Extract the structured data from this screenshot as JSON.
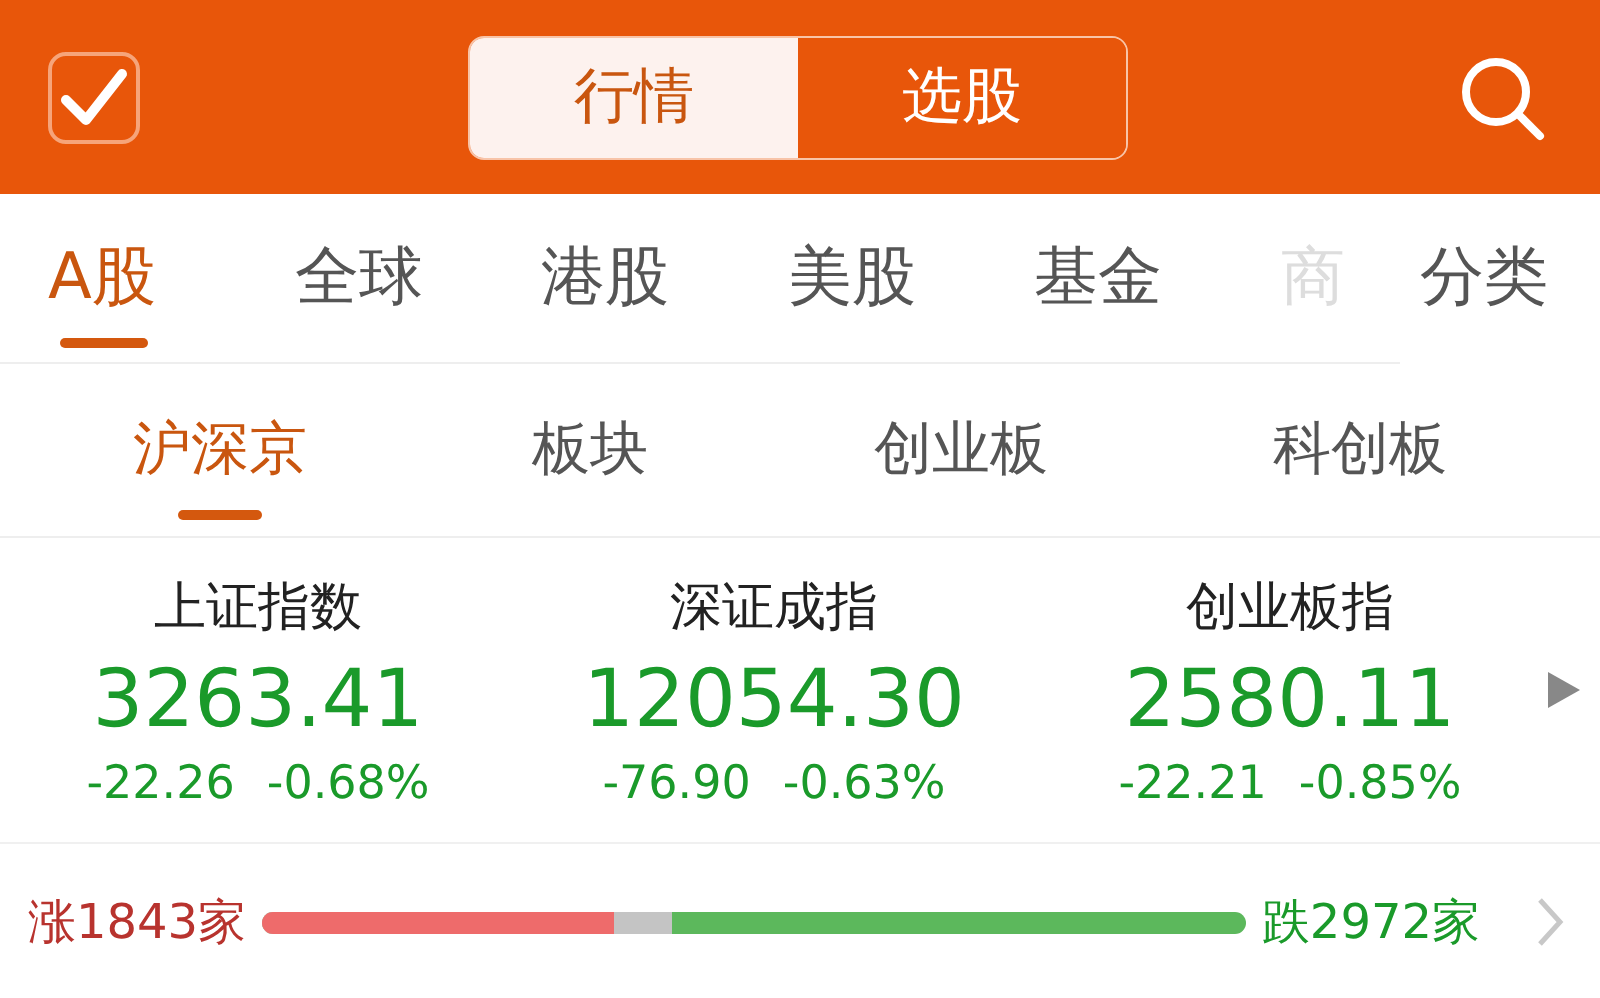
{
  "header": {
    "segments": [
      {
        "label": "行情",
        "selected": true
      },
      {
        "label": "选股",
        "selected": false
      }
    ]
  },
  "market_tabs": [
    {
      "label": "A股",
      "selected": true
    },
    {
      "label": "全球",
      "selected": false
    },
    {
      "label": "港股",
      "selected": false
    },
    {
      "label": "美股",
      "selected": false
    },
    {
      "label": "基金",
      "selected": false
    },
    {
      "label": "商",
      "selected": false
    }
  ],
  "category_button": "分类",
  "sub_tabs": [
    {
      "label": "沪深京",
      "selected": true
    },
    {
      "label": "板块",
      "selected": false
    },
    {
      "label": "创业板",
      "selected": false
    },
    {
      "label": "科创板",
      "selected": false
    }
  ],
  "indices": [
    {
      "name": "上证指数",
      "value": "3263.41",
      "change": "-22.26",
      "percent": "-0.68%"
    },
    {
      "name": "深证成指",
      "value": "12054.30",
      "change": "-76.90",
      "percent": "-0.63%"
    },
    {
      "name": "创业板指",
      "value": "2580.11",
      "change": "-22.21",
      "percent": "-0.85%"
    }
  ],
  "breadth": {
    "up_label": "涨1843家",
    "down_label": "跌2972家",
    "fills": [
      {
        "kind": "flat",
        "level": 0.416
      },
      {
        "kind": "up",
        "level": 0.358
      }
    ]
  }
}
